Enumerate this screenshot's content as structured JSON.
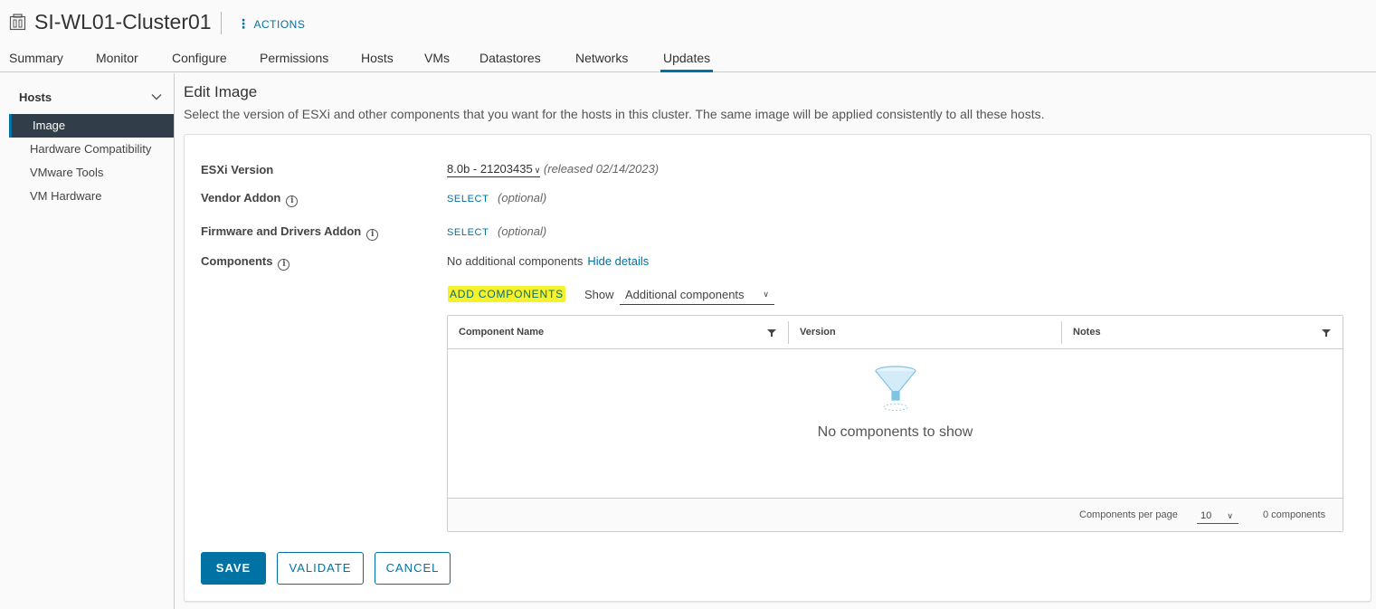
{
  "header": {
    "title": "SI-WL01-Cluster01",
    "actions_label": "ACTIONS",
    "cluster_icon": "cluster-icon"
  },
  "tabs": [
    {
      "label": "Summary"
    },
    {
      "label": "Monitor"
    },
    {
      "label": "Configure"
    },
    {
      "label": "Permissions"
    },
    {
      "label": "Hosts"
    },
    {
      "label": "VMs"
    },
    {
      "label": "Datastores"
    },
    {
      "label": "Networks"
    },
    {
      "label": "Updates",
      "active": true
    }
  ],
  "sidebar": {
    "group_label": "Hosts",
    "items": [
      {
        "label": "Image",
        "active": true
      },
      {
        "label": "Hardware Compatibility"
      },
      {
        "label": "VMware Tools"
      },
      {
        "label": "VM Hardware"
      }
    ]
  },
  "main": {
    "title": "Edit Image",
    "description": "Select the version of ESXi and other components that you want for the hosts in this cluster. The same image will be applied consistently to all these hosts."
  },
  "form": {
    "esxi_label": "ESXi Version",
    "esxi_value": "8.0b - 21203435",
    "esxi_released": "(released 02/14/2023)",
    "vendor_label": "Vendor Addon",
    "vendor_select": "SELECT",
    "vendor_optional": "(optional)",
    "firmware_label": "Firmware and Drivers Addon",
    "firmware_select": "SELECT",
    "firmware_optional": "(optional)",
    "components_label": "Components",
    "components_value": "No additional components",
    "hide_details": "Hide details",
    "add_components": "ADD COMPONENTS",
    "show_label": "Show",
    "show_value": "Additional components"
  },
  "grid": {
    "columns": [
      "Component Name",
      "Version",
      "Notes"
    ],
    "empty_text": "No components to show",
    "per_page_label": "Components per page",
    "per_page_value": "10",
    "count_text": "0 components"
  },
  "buttons": {
    "save": "SAVE",
    "validate": "VALIDATE",
    "cancel": "CANCEL"
  },
  "colors": {
    "accent": "#0072a3",
    "highlight": "#f5f12a",
    "sidebar_active_bg": "#313d48"
  }
}
